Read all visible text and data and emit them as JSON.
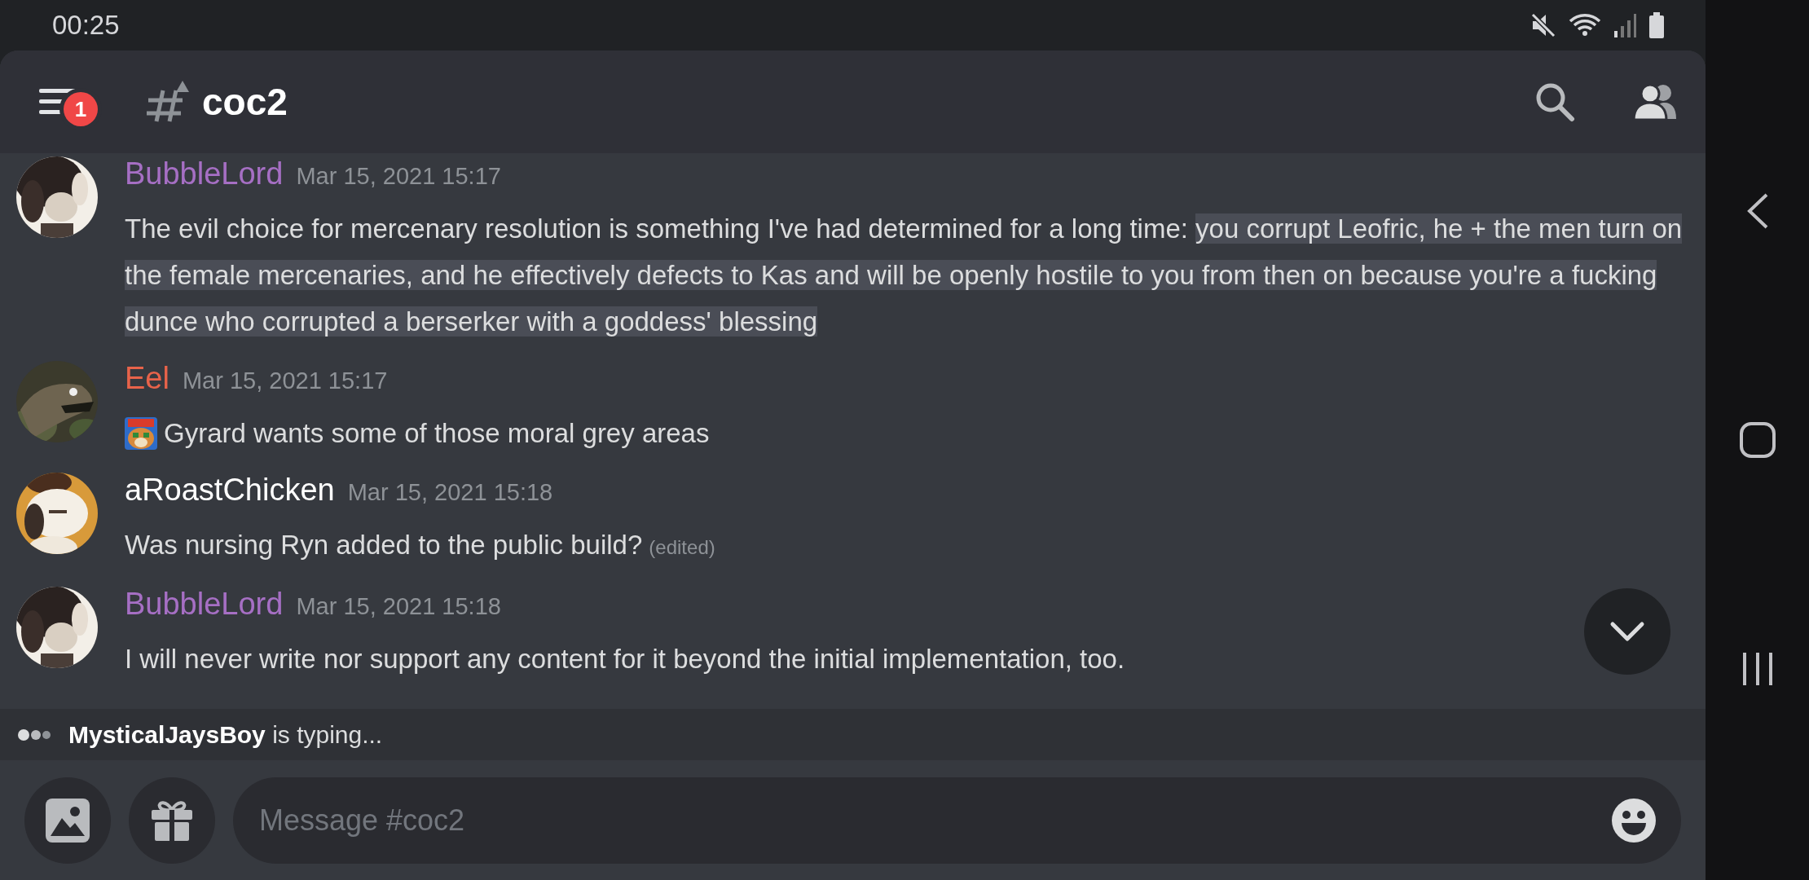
{
  "status_bar": {
    "time": "00:25"
  },
  "header": {
    "menu_badge": "1",
    "channel": "coc2"
  },
  "messages": [
    {
      "author": "BubbleLord",
      "color": "#a66fc4",
      "time": "Mar 15, 2021 15:17",
      "segments": [
        {
          "text": "The evil choice for mercenary resolution is something I've had determined for a long time: ",
          "selected": false
        },
        {
          "text": "you corrupt Leofric, he + the men turn on the female mercenaries, and he effectively defects to Kas and will be openly hostile to you from then on because you're a fucking dunce who corrupted a berserker with a goddess' blessing",
          "selected": true
        }
      ]
    },
    {
      "author": "Eel",
      "color": "#e8634a",
      "time": "Mar 15, 2021 15:17",
      "emoji": true,
      "segments": [
        {
          "text": "Gyrard wants some of those moral grey areas",
          "selected": false
        }
      ]
    },
    {
      "author": "aRoastChicken",
      "color": "#ffffff",
      "time": "Mar 15, 2021 15:18",
      "segments": [
        {
          "text": "Was nursing Ryn added to the public build?",
          "selected": false
        }
      ],
      "edited_label": "(edited)"
    },
    {
      "author": "BubbleLord",
      "color": "#a66fc4",
      "time": "Mar 15, 2021 15:18",
      "segments": [
        {
          "text": "I will never write nor support any content for it beyond the initial implementation, too.",
          "selected": false
        }
      ]
    }
  ],
  "typing": "**MysticalJaysBoy** is typing...",
  "composer": {
    "placeholder": "Message #coc2"
  }
}
